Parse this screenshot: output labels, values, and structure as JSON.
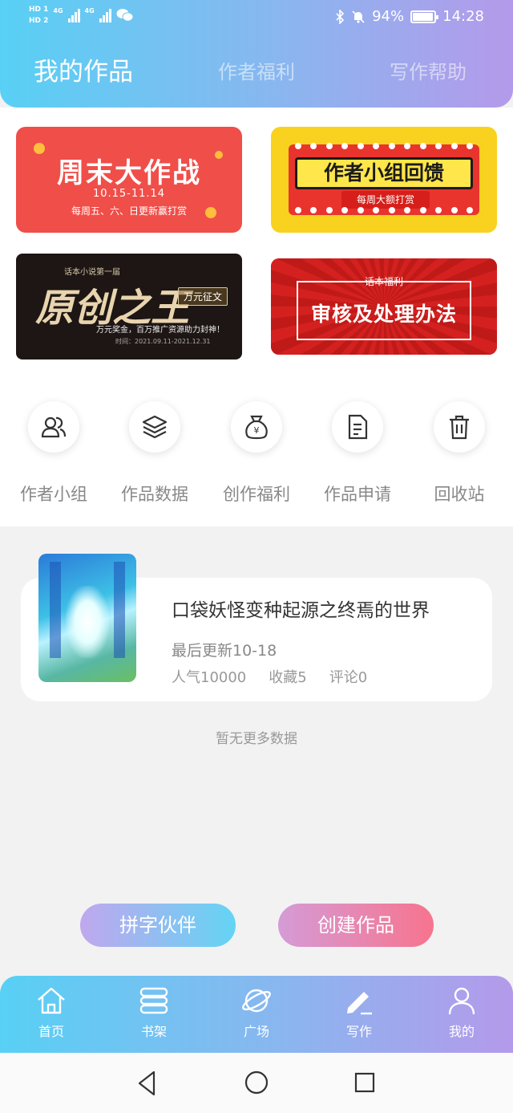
{
  "status_bar": {
    "hd1": "HD 1",
    "hd2": "HD 2",
    "net1": "4G",
    "net2": "4G",
    "battery_percent": "94%",
    "battery_level": 0.94,
    "time": "14:28"
  },
  "tabs": [
    {
      "label": "我的作品",
      "active": true
    },
    {
      "label": "作者福利",
      "active": false
    },
    {
      "label": "写作帮助",
      "active": false
    }
  ],
  "banners": {
    "weekend": {
      "title": "周末大作战",
      "date": "10.15-11.14",
      "subtitle": "每周五、六、日更新赢打赏"
    },
    "feedback": {
      "title": "作者小组回馈",
      "subtitle": "每周大额打赏"
    },
    "original_king": {
      "top": "话本小说第一届",
      "title": "原创之王",
      "tag": "万元征文",
      "subtitle": "万元奖金，百万推广资源助力封神！",
      "time": "时间：2021.09.11-2021.12.31"
    },
    "review": {
      "top": "话本福利",
      "title": "审核及处理办法"
    }
  },
  "quick_links": [
    {
      "label": "作者小组",
      "icon": "author-group-icon"
    },
    {
      "label": "作品数据",
      "icon": "layers-icon"
    },
    {
      "label": "创作福利",
      "icon": "money-bag-icon"
    },
    {
      "label": "作品申请",
      "icon": "document-icon"
    },
    {
      "label": "回收站",
      "icon": "trash-icon"
    }
  ],
  "work": {
    "title": "口袋妖怪变种起源之终焉的世界",
    "last_update": "最后更新10-18",
    "popularity": "人气10000",
    "favorites": "收藏5",
    "comments": "评论0"
  },
  "no_more": "暂无更多数据",
  "buttons": {
    "partner": "拼字伙伴",
    "create": "创建作品"
  },
  "bottom_nav": [
    {
      "label": "首页",
      "icon": "home-icon"
    },
    {
      "label": "书架",
      "icon": "bookshelf-icon"
    },
    {
      "label": "广场",
      "icon": "planet-icon"
    },
    {
      "label": "写作",
      "icon": "pen-icon"
    },
    {
      "label": "我的",
      "icon": "user-icon"
    }
  ],
  "colors": {
    "header_start": "#58d0f5",
    "header_mid": "#8ab6ef",
    "header_end": "#b49aea",
    "create_button": "#f7748e"
  }
}
